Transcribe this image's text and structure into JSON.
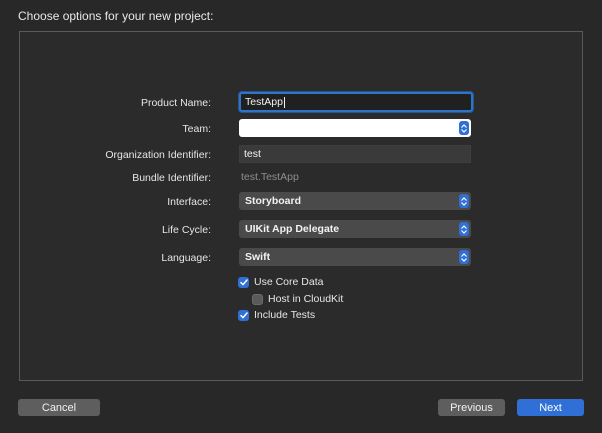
{
  "dialog": {
    "title": "Choose options for your new project:"
  },
  "form": {
    "product_name": {
      "label": "Product Name:",
      "value": "TestApp"
    },
    "team": {
      "label": "Team:",
      "value": ""
    },
    "organization_identifier": {
      "label": "Organization Identifier:",
      "value": "test"
    },
    "bundle_identifier": {
      "label": "Bundle Identifier:",
      "value": "test.TestApp"
    },
    "interface": {
      "label": "Interface:",
      "value": "Storyboard"
    },
    "life_cycle": {
      "label": "Life Cycle:",
      "value": "UIKit App Delegate"
    },
    "language": {
      "label": "Language:",
      "value": "Swift"
    }
  },
  "options": {
    "use_core_data": {
      "label": "Use Core Data",
      "checked": true
    },
    "host_in_cloudkit": {
      "label": "Host in CloudKit",
      "checked": false
    },
    "include_tests": {
      "label": "Include Tests",
      "checked": true
    }
  },
  "buttons": {
    "cancel": "Cancel",
    "previous": "Previous",
    "next": "Next"
  },
  "colors": {
    "accent": "#2f6fd6",
    "background": "#282828",
    "panel_border": "#5a5a5a"
  },
  "icons": {
    "stepper": "chevron-up-down-icon",
    "check": "checkmark-icon"
  }
}
